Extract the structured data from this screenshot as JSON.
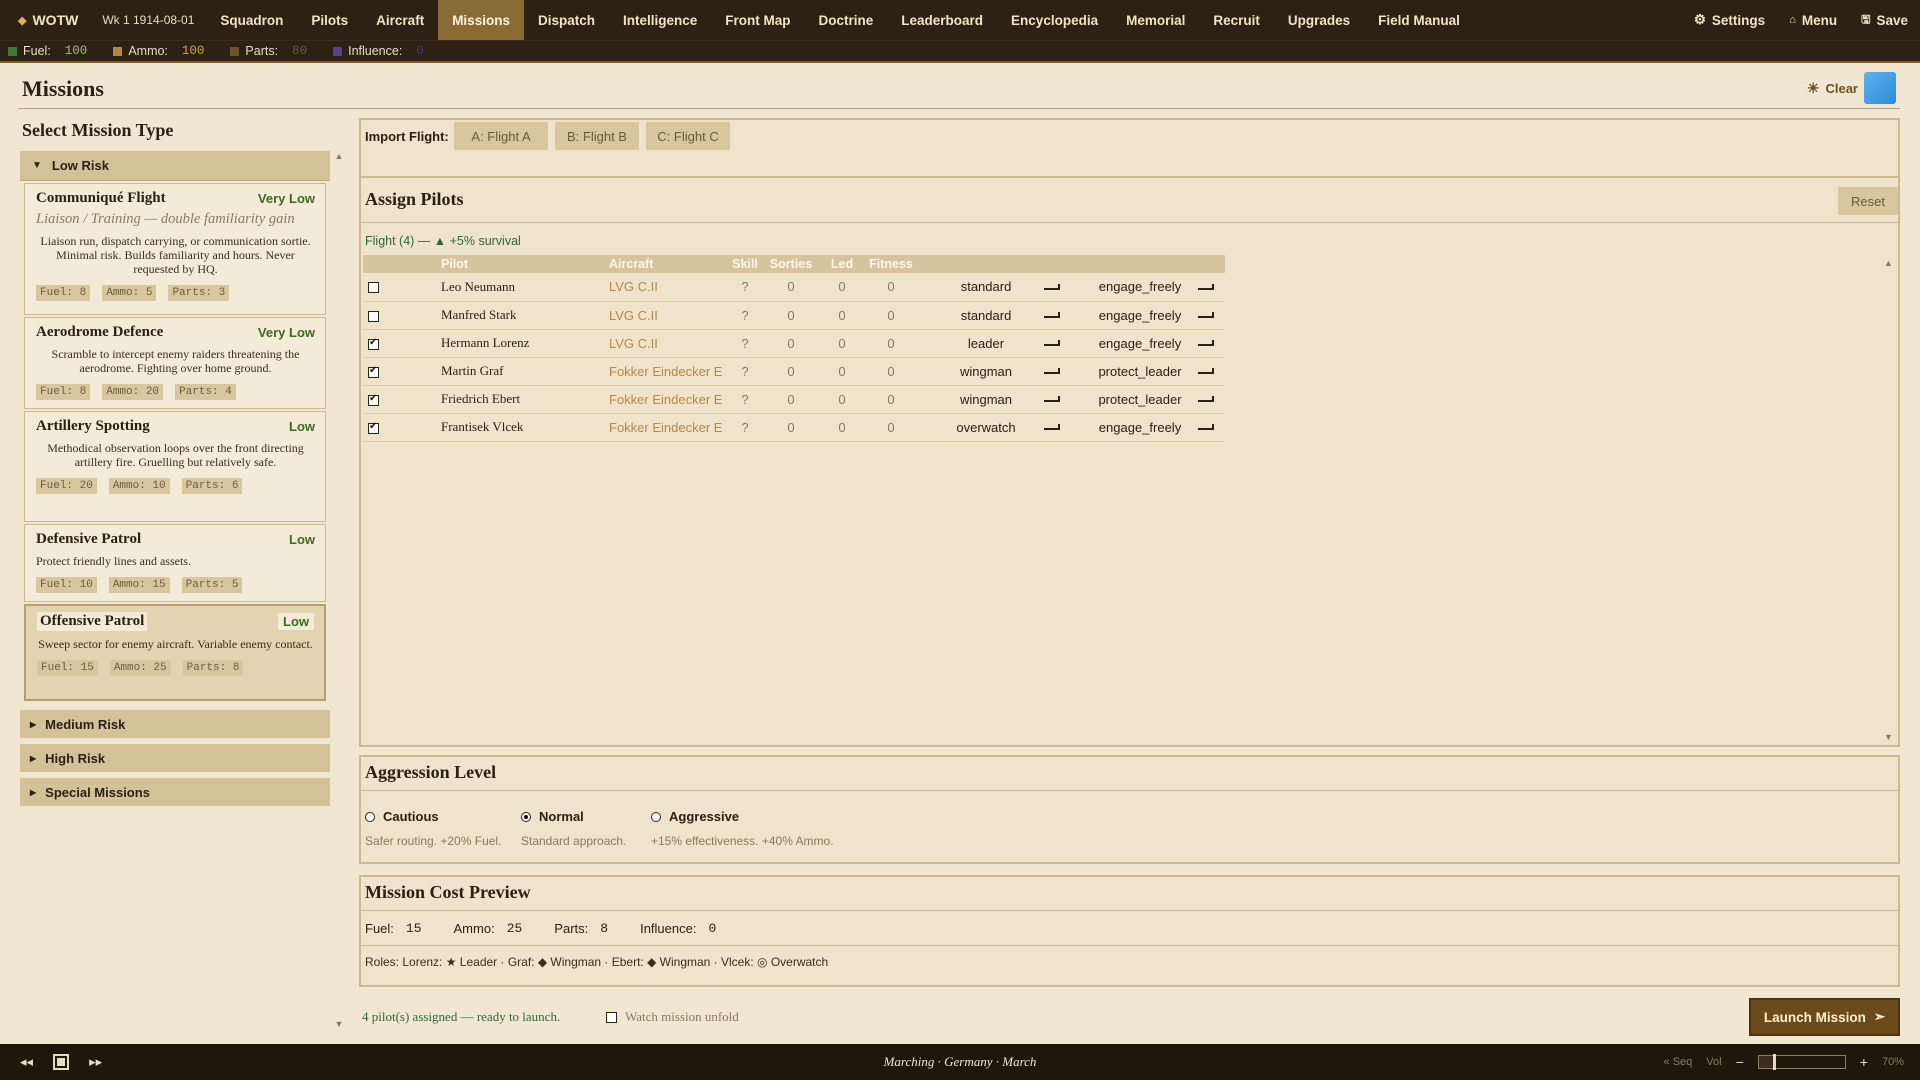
{
  "topbar": {
    "brand": "WOTW",
    "date": "Wk 1  1914-08-01",
    "nav": [
      "Squadron",
      "Pilots",
      "Aircraft",
      "Missions",
      "Dispatch",
      "Intelligence",
      "Front Map",
      "Doctrine",
      "Leaderboard",
      "Encyclopedia",
      "Memorial",
      "Recruit",
      "Upgrades",
      "Field Manual"
    ],
    "active_nav": "Missions",
    "settings_label": "Settings",
    "menu_label": "Menu",
    "save_label": "Save"
  },
  "resources": [
    {
      "label": "Fuel:",
      "value": "100",
      "color": "#3f7a3a",
      "value_color": "#a0c07a"
    },
    {
      "label": "Ammo:",
      "value": "100",
      "color": "#b08a3a",
      "value_color": "#c8a45a"
    },
    {
      "label": "Parts:",
      "value": "80",
      "color": "#6b5330",
      "value_color": "#6b5a3a"
    },
    {
      "label": "Influence:",
      "value": "0",
      "color": "#5a3f8a",
      "value_color": "#4a3a6a"
    }
  ],
  "page": {
    "title": "Missions",
    "clear_label": "Clear"
  },
  "select": {
    "title": "Select Mission Type",
    "low_risk_label": "Low Risk",
    "missions": [
      {
        "name": "Communiqué Flight",
        "risk": "Very Low",
        "subtitle": "Liaison / Training  —  double familiarity gain",
        "desc": "Liaison run, dispatch carrying, or communication sortie. Minimal risk. Builds familiarity and hours. Never requested by HQ.",
        "costs": [
          "Fuel: 8",
          "Ammo: 5",
          "Parts: 3"
        ]
      },
      {
        "name": "Aerodrome Defence",
        "risk": "Very Low",
        "desc": "Scramble to intercept enemy raiders threatening the aerodrome. Fighting over home ground.",
        "costs": [
          "Fuel: 8",
          "Ammo: 20",
          "Parts: 4"
        ]
      },
      {
        "name": "Artillery Spotting",
        "risk": "Low",
        "desc": "Methodical observation loops over the front directing artillery fire. Gruelling but relatively safe.",
        "costs": [
          "Fuel: 20",
          "Ammo: 10",
          "Parts: 6"
        ]
      },
      {
        "name": "Defensive Patrol",
        "risk": "Low",
        "desc": "Protect friendly lines and assets.",
        "costs": [
          "Fuel: 10",
          "Ammo: 15",
          "Parts: 5"
        ]
      },
      {
        "name": "Offensive Patrol",
        "risk": "Low",
        "desc": "Sweep sector for enemy aircraft. Variable enemy contact.",
        "costs": [
          "Fuel: 15",
          "Ammo: 25",
          "Parts: 8"
        ]
      }
    ],
    "groups": [
      "Medium Risk",
      "High Risk",
      "Special Missions"
    ]
  },
  "import": {
    "label": "Import Flight:",
    "buttons": [
      "A: Flight A",
      "B: Flight B",
      "C: Flight C"
    ]
  },
  "assign": {
    "title": "Assign Pilots",
    "reset_label": "Reset",
    "flight_line": "Flight (4)  —  ▲ +5% survival",
    "columns": [
      "",
      "Pilot",
      "Aircraft",
      "Skill",
      "Sorties",
      "Led",
      "Fitness",
      "",
      ""
    ],
    "rows": [
      {
        "checked": false,
        "pilot": "Leo Neumann",
        "aircraft": "LVG C.II",
        "skill": "?",
        "sorties": "0",
        "led": "0",
        "fitness": "0",
        "role": "standard",
        "order": "engage_freely"
      },
      {
        "checked": false,
        "pilot": "Manfred Stark",
        "aircraft": "LVG C.II",
        "skill": "?",
        "sorties": "0",
        "led": "0",
        "fitness": "0",
        "role": "standard",
        "order": "engage_freely"
      },
      {
        "checked": true,
        "pilot": "Hermann Lorenz",
        "aircraft": "LVG C.II",
        "skill": "?",
        "sorties": "0",
        "led": "0",
        "fitness": "0",
        "role": "leader",
        "order": "engage_freely"
      },
      {
        "checked": true,
        "pilot": "Martin Graf",
        "aircraft": "Fokker Eindecker E",
        "skill": "?",
        "sorties": "0",
        "led": "0",
        "fitness": "0",
        "role": "wingman",
        "order": "protect_leader"
      },
      {
        "checked": true,
        "pilot": "Friedrich Ebert",
        "aircraft": "Fokker Eindecker E",
        "skill": "?",
        "sorties": "0",
        "led": "0",
        "fitness": "0",
        "role": "wingman",
        "order": "protect_leader"
      },
      {
        "checked": true,
        "pilot": "Frantisek Vlcek",
        "aircraft": "Fokker Eindecker E",
        "skill": "?",
        "sorties": "0",
        "led": "0",
        "fitness": "0",
        "role": "overwatch",
        "order": "engage_freely"
      }
    ]
  },
  "aggression": {
    "title": "Aggression Level",
    "options": [
      {
        "label": "Cautious",
        "desc": "Safer routing. +20% Fuel.",
        "selected": false
      },
      {
        "label": "Normal",
        "desc": "Standard approach.",
        "selected": true
      },
      {
        "label": "Aggressive",
        "desc": "+15% effectiveness. +40% Ammo.",
        "selected": false
      }
    ]
  },
  "cost": {
    "title": "Mission Cost Preview",
    "items": [
      {
        "label": "Fuel:",
        "value": "15"
      },
      {
        "label": "Ammo:",
        "value": "25"
      },
      {
        "label": "Parts:",
        "value": "8"
      },
      {
        "label": "Influence:",
        "value": "0"
      }
    ],
    "roles_line": "Roles: Lorenz: ★ Leader  ·  Graf: ◆ Wingman  ·  Ebert: ◆ Wingman  ·  Vlcek: ◎ Overwatch"
  },
  "footer": {
    "status": "4 pilot(s) assigned — ready to launch.",
    "watch_label": "Watch mission unfold",
    "launch_label": "Launch Mission"
  },
  "player": {
    "track": "Marching  ·  Germany  ·  March",
    "seq_label": "« Seq",
    "vol_label": "Vol",
    "volume_percent": "70%",
    "volume_fraction": 0.18
  }
}
